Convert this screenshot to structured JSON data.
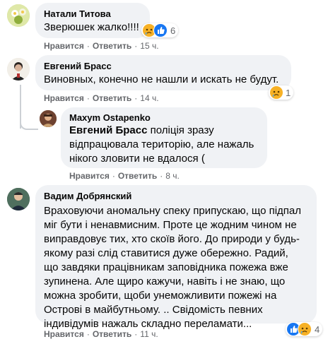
{
  "comments": [
    {
      "author": "Натали Титова",
      "text": "Зверюшек жалко!!!!",
      "actions": {
        "like": "Нравится",
        "reply": "Ответить",
        "time": "15 ч."
      },
      "reactions": {
        "icons": [
          "sad-face-icon",
          "like-icon"
        ],
        "count": "6"
      }
    },
    {
      "author": "Евгений Брасс",
      "text": "Виновных, конечно не нашли и искать не будут.",
      "actions": {
        "like": "Нравится",
        "reply": "Ответить",
        "time": "14 ч."
      },
      "reactions": {
        "icons": [
          "sad-face-icon"
        ],
        "count": "1"
      }
    },
    {
      "author": "Maxym Ostapenko",
      "mention": "Евгений Брасс",
      "text": "поліція зразу відпрацювала територію, але нажаль нікого зловити не вдалося (",
      "actions": {
        "like": "Нравится",
        "reply": "Ответить",
        "time": "8 ч."
      }
    },
    {
      "author": "Вадим Добрянский",
      "text": "Враховуючи аномальну спеку припускаю, що підпал міг бути і ненавмисним. Проте це жодним чином не виправдовує тих, хто скоїв його. До природи у будь-якому разі слід ставитися дуже обережно. Радий, що завдяки працівникам заповідника пожежа вже зупинена. Але щиро кажучи, навіть і не знаю, що можна зробити, щоби унеможливити пожежі на Острові в майбутньому. .. Свідомість певних індивідумів нажаль складно переламати...",
      "actions": {
        "like": "Нравится",
        "reply": "Ответить",
        "time": "11 ч."
      },
      "reactions": {
        "icons": [
          "like-icon",
          "sad-face-icon"
        ],
        "count": "4"
      }
    }
  ],
  "colors": {
    "bubble": "#f0f2f5",
    "meta_text": "#65676b",
    "like_blue": "#1877f2",
    "sad_yellow": "#f7b125"
  }
}
